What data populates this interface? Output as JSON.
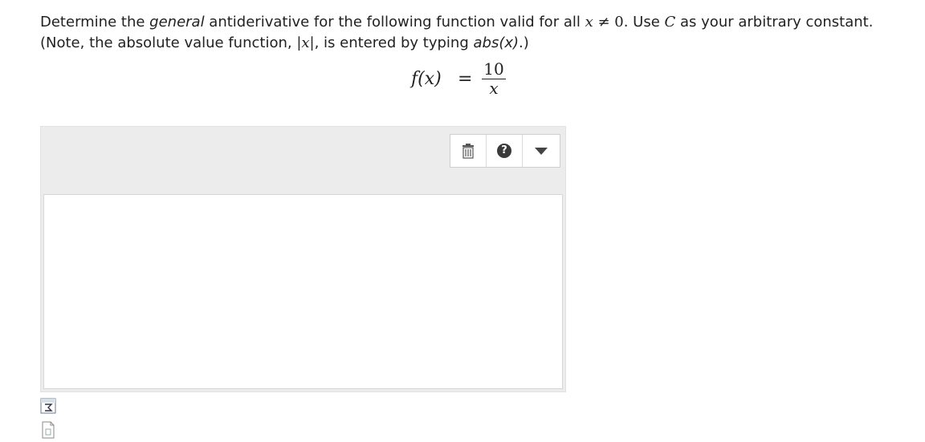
{
  "question": {
    "part1": "Determine the ",
    "emph": "general",
    "part2": " antiderivative for the following function valid for all ",
    "cond_var": "x",
    "cond_rel": " ≠ 0",
    "part3": ". Use ",
    "const_name": "C",
    "part4": " as your arbitrary constant. (Note, the absolute value function, ",
    "abs_expr": "|x|",
    "part5": ", is entered by typing ",
    "abs_code": "abs(x)",
    "part6": ".)"
  },
  "formula": {
    "lhs": "f(x)",
    "equals": "=",
    "numerator": "10",
    "denominator": "x"
  },
  "icons": {
    "trash": "trash-icon",
    "help": "help-icon",
    "dropdown": "dropdown-arrow-icon",
    "equation_editor": "equation-editor-icon",
    "document": "document-icon"
  },
  "toolbar": {
    "help_glyph": "?"
  }
}
